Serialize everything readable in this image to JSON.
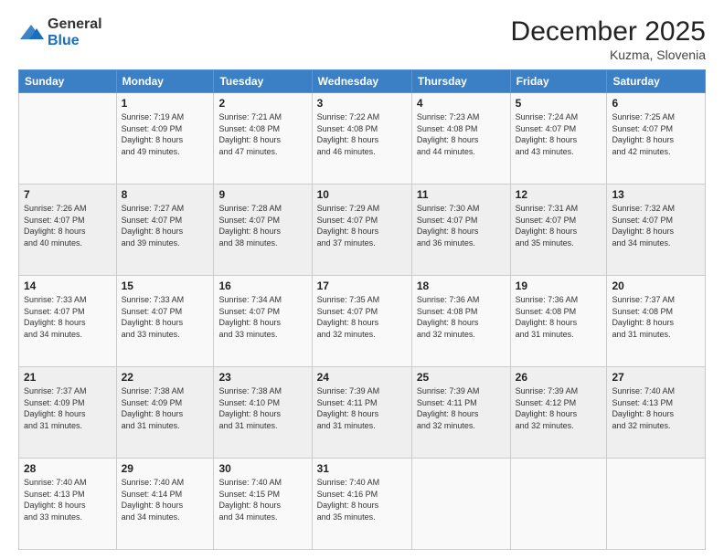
{
  "logo": {
    "general": "General",
    "blue": "Blue"
  },
  "title": "December 2025",
  "location": "Kuzma, Slovenia",
  "days_header": [
    "Sunday",
    "Monday",
    "Tuesday",
    "Wednesday",
    "Thursday",
    "Friday",
    "Saturday"
  ],
  "weeks": [
    [
      {
        "day": "",
        "info": ""
      },
      {
        "day": "1",
        "info": "Sunrise: 7:19 AM\nSunset: 4:09 PM\nDaylight: 8 hours\nand 49 minutes."
      },
      {
        "day": "2",
        "info": "Sunrise: 7:21 AM\nSunset: 4:08 PM\nDaylight: 8 hours\nand 47 minutes."
      },
      {
        "day": "3",
        "info": "Sunrise: 7:22 AM\nSunset: 4:08 PM\nDaylight: 8 hours\nand 46 minutes."
      },
      {
        "day": "4",
        "info": "Sunrise: 7:23 AM\nSunset: 4:08 PM\nDaylight: 8 hours\nand 44 minutes."
      },
      {
        "day": "5",
        "info": "Sunrise: 7:24 AM\nSunset: 4:07 PM\nDaylight: 8 hours\nand 43 minutes."
      },
      {
        "day": "6",
        "info": "Sunrise: 7:25 AM\nSunset: 4:07 PM\nDaylight: 8 hours\nand 42 minutes."
      }
    ],
    [
      {
        "day": "7",
        "info": "Sunrise: 7:26 AM\nSunset: 4:07 PM\nDaylight: 8 hours\nand 40 minutes."
      },
      {
        "day": "8",
        "info": "Sunrise: 7:27 AM\nSunset: 4:07 PM\nDaylight: 8 hours\nand 39 minutes."
      },
      {
        "day": "9",
        "info": "Sunrise: 7:28 AM\nSunset: 4:07 PM\nDaylight: 8 hours\nand 38 minutes."
      },
      {
        "day": "10",
        "info": "Sunrise: 7:29 AM\nSunset: 4:07 PM\nDaylight: 8 hours\nand 37 minutes."
      },
      {
        "day": "11",
        "info": "Sunrise: 7:30 AM\nSunset: 4:07 PM\nDaylight: 8 hours\nand 36 minutes."
      },
      {
        "day": "12",
        "info": "Sunrise: 7:31 AM\nSunset: 4:07 PM\nDaylight: 8 hours\nand 35 minutes."
      },
      {
        "day": "13",
        "info": "Sunrise: 7:32 AM\nSunset: 4:07 PM\nDaylight: 8 hours\nand 34 minutes."
      }
    ],
    [
      {
        "day": "14",
        "info": "Sunrise: 7:33 AM\nSunset: 4:07 PM\nDaylight: 8 hours\nand 34 minutes."
      },
      {
        "day": "15",
        "info": "Sunrise: 7:33 AM\nSunset: 4:07 PM\nDaylight: 8 hours\nand 33 minutes."
      },
      {
        "day": "16",
        "info": "Sunrise: 7:34 AM\nSunset: 4:07 PM\nDaylight: 8 hours\nand 33 minutes."
      },
      {
        "day": "17",
        "info": "Sunrise: 7:35 AM\nSunset: 4:07 PM\nDaylight: 8 hours\nand 32 minutes."
      },
      {
        "day": "18",
        "info": "Sunrise: 7:36 AM\nSunset: 4:08 PM\nDaylight: 8 hours\nand 32 minutes."
      },
      {
        "day": "19",
        "info": "Sunrise: 7:36 AM\nSunset: 4:08 PM\nDaylight: 8 hours\nand 31 minutes."
      },
      {
        "day": "20",
        "info": "Sunrise: 7:37 AM\nSunset: 4:08 PM\nDaylight: 8 hours\nand 31 minutes."
      }
    ],
    [
      {
        "day": "21",
        "info": "Sunrise: 7:37 AM\nSunset: 4:09 PM\nDaylight: 8 hours\nand 31 minutes."
      },
      {
        "day": "22",
        "info": "Sunrise: 7:38 AM\nSunset: 4:09 PM\nDaylight: 8 hours\nand 31 minutes."
      },
      {
        "day": "23",
        "info": "Sunrise: 7:38 AM\nSunset: 4:10 PM\nDaylight: 8 hours\nand 31 minutes."
      },
      {
        "day": "24",
        "info": "Sunrise: 7:39 AM\nSunset: 4:11 PM\nDaylight: 8 hours\nand 31 minutes."
      },
      {
        "day": "25",
        "info": "Sunrise: 7:39 AM\nSunset: 4:11 PM\nDaylight: 8 hours\nand 32 minutes."
      },
      {
        "day": "26",
        "info": "Sunrise: 7:39 AM\nSunset: 4:12 PM\nDaylight: 8 hours\nand 32 minutes."
      },
      {
        "day": "27",
        "info": "Sunrise: 7:40 AM\nSunset: 4:13 PM\nDaylight: 8 hours\nand 32 minutes."
      }
    ],
    [
      {
        "day": "28",
        "info": "Sunrise: 7:40 AM\nSunset: 4:13 PM\nDaylight: 8 hours\nand 33 minutes."
      },
      {
        "day": "29",
        "info": "Sunrise: 7:40 AM\nSunset: 4:14 PM\nDaylight: 8 hours\nand 34 minutes."
      },
      {
        "day": "30",
        "info": "Sunrise: 7:40 AM\nSunset: 4:15 PM\nDaylight: 8 hours\nand 34 minutes."
      },
      {
        "day": "31",
        "info": "Sunrise: 7:40 AM\nSunset: 4:16 PM\nDaylight: 8 hours\nand 35 minutes."
      },
      {
        "day": "",
        "info": ""
      },
      {
        "day": "",
        "info": ""
      },
      {
        "day": "",
        "info": ""
      }
    ]
  ]
}
